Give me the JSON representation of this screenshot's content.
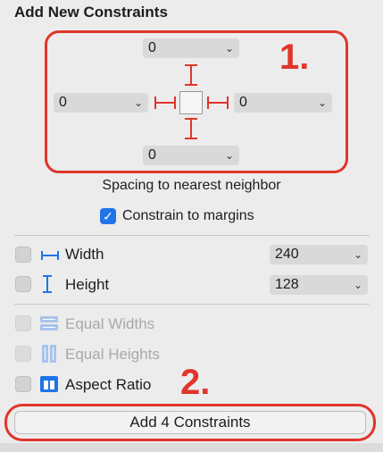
{
  "panel": {
    "title": "Add New Constraints",
    "spacing": {
      "top": "0",
      "left": "0",
      "right": "0",
      "bottom": "0",
      "caption": "Spacing to nearest neighbor"
    },
    "constrain_to_margins": {
      "label": "Constrain to margins",
      "checked": true
    },
    "width": {
      "label": "Width",
      "value": "240",
      "checked": false
    },
    "height": {
      "label": "Height",
      "value": "128",
      "checked": false
    },
    "equal_widths": {
      "label": "Equal Widths",
      "enabled": false
    },
    "equal_heights": {
      "label": "Equal Heights",
      "enabled": false
    },
    "aspect_ratio": {
      "label": "Aspect Ratio",
      "checked": false
    },
    "add_button": "Add 4 Constraints"
  },
  "annotations": {
    "step1": "1.",
    "step2": "2.",
    "color": "#e0352b"
  },
  "icons": {
    "chevron": "chevron-down-icon",
    "check": "checkmark-icon",
    "width": "width-icon",
    "height": "height-icon",
    "equal_widths": "equal-widths-icon",
    "equal_heights": "equal-heights-icon",
    "aspect_ratio": "aspect-ratio-icon"
  }
}
